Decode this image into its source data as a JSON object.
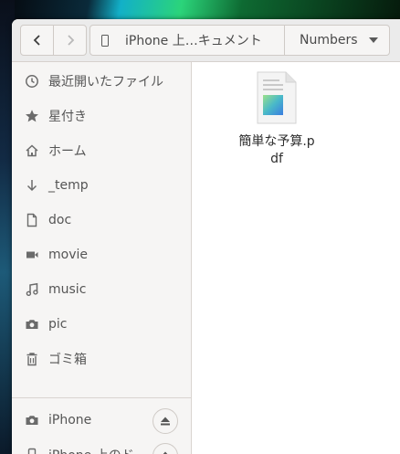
{
  "window": {
    "nav": {
      "back_icon": "chevron-left",
      "forward_icon": "chevron-right"
    },
    "path": {
      "current": "iPhone 上…キュメント",
      "next": "Numbers"
    }
  },
  "sidebar": {
    "items": [
      {
        "label": "最近開いたファイル",
        "icon": "clock-icon"
      },
      {
        "label": "星付き",
        "icon": "star-icon"
      },
      {
        "label": "ホーム",
        "icon": "home-icon"
      },
      {
        "label": "_temp",
        "icon": "arrow-down-icon"
      },
      {
        "label": "doc",
        "icon": "document-icon"
      },
      {
        "label": "movie",
        "icon": "film-icon"
      },
      {
        "label": "music",
        "icon": "music-note-icon"
      },
      {
        "label": "pic",
        "icon": "camera-icon"
      },
      {
        "label": "ゴミ箱",
        "icon": "trash-icon"
      }
    ],
    "devices": [
      {
        "label": "iPhone",
        "icon": "camera-icon"
      },
      {
        "label": "iPhone 上のド…",
        "icon": "phone-icon"
      }
    ]
  },
  "files": [
    {
      "name": "簡単な予算.pdf",
      "icon": "pdf-file-icon"
    }
  ],
  "colors": {
    "accent": "#3584e4",
    "sidebar_bg": "#f6f5f4",
    "header_bg": "#ebebeb"
  }
}
